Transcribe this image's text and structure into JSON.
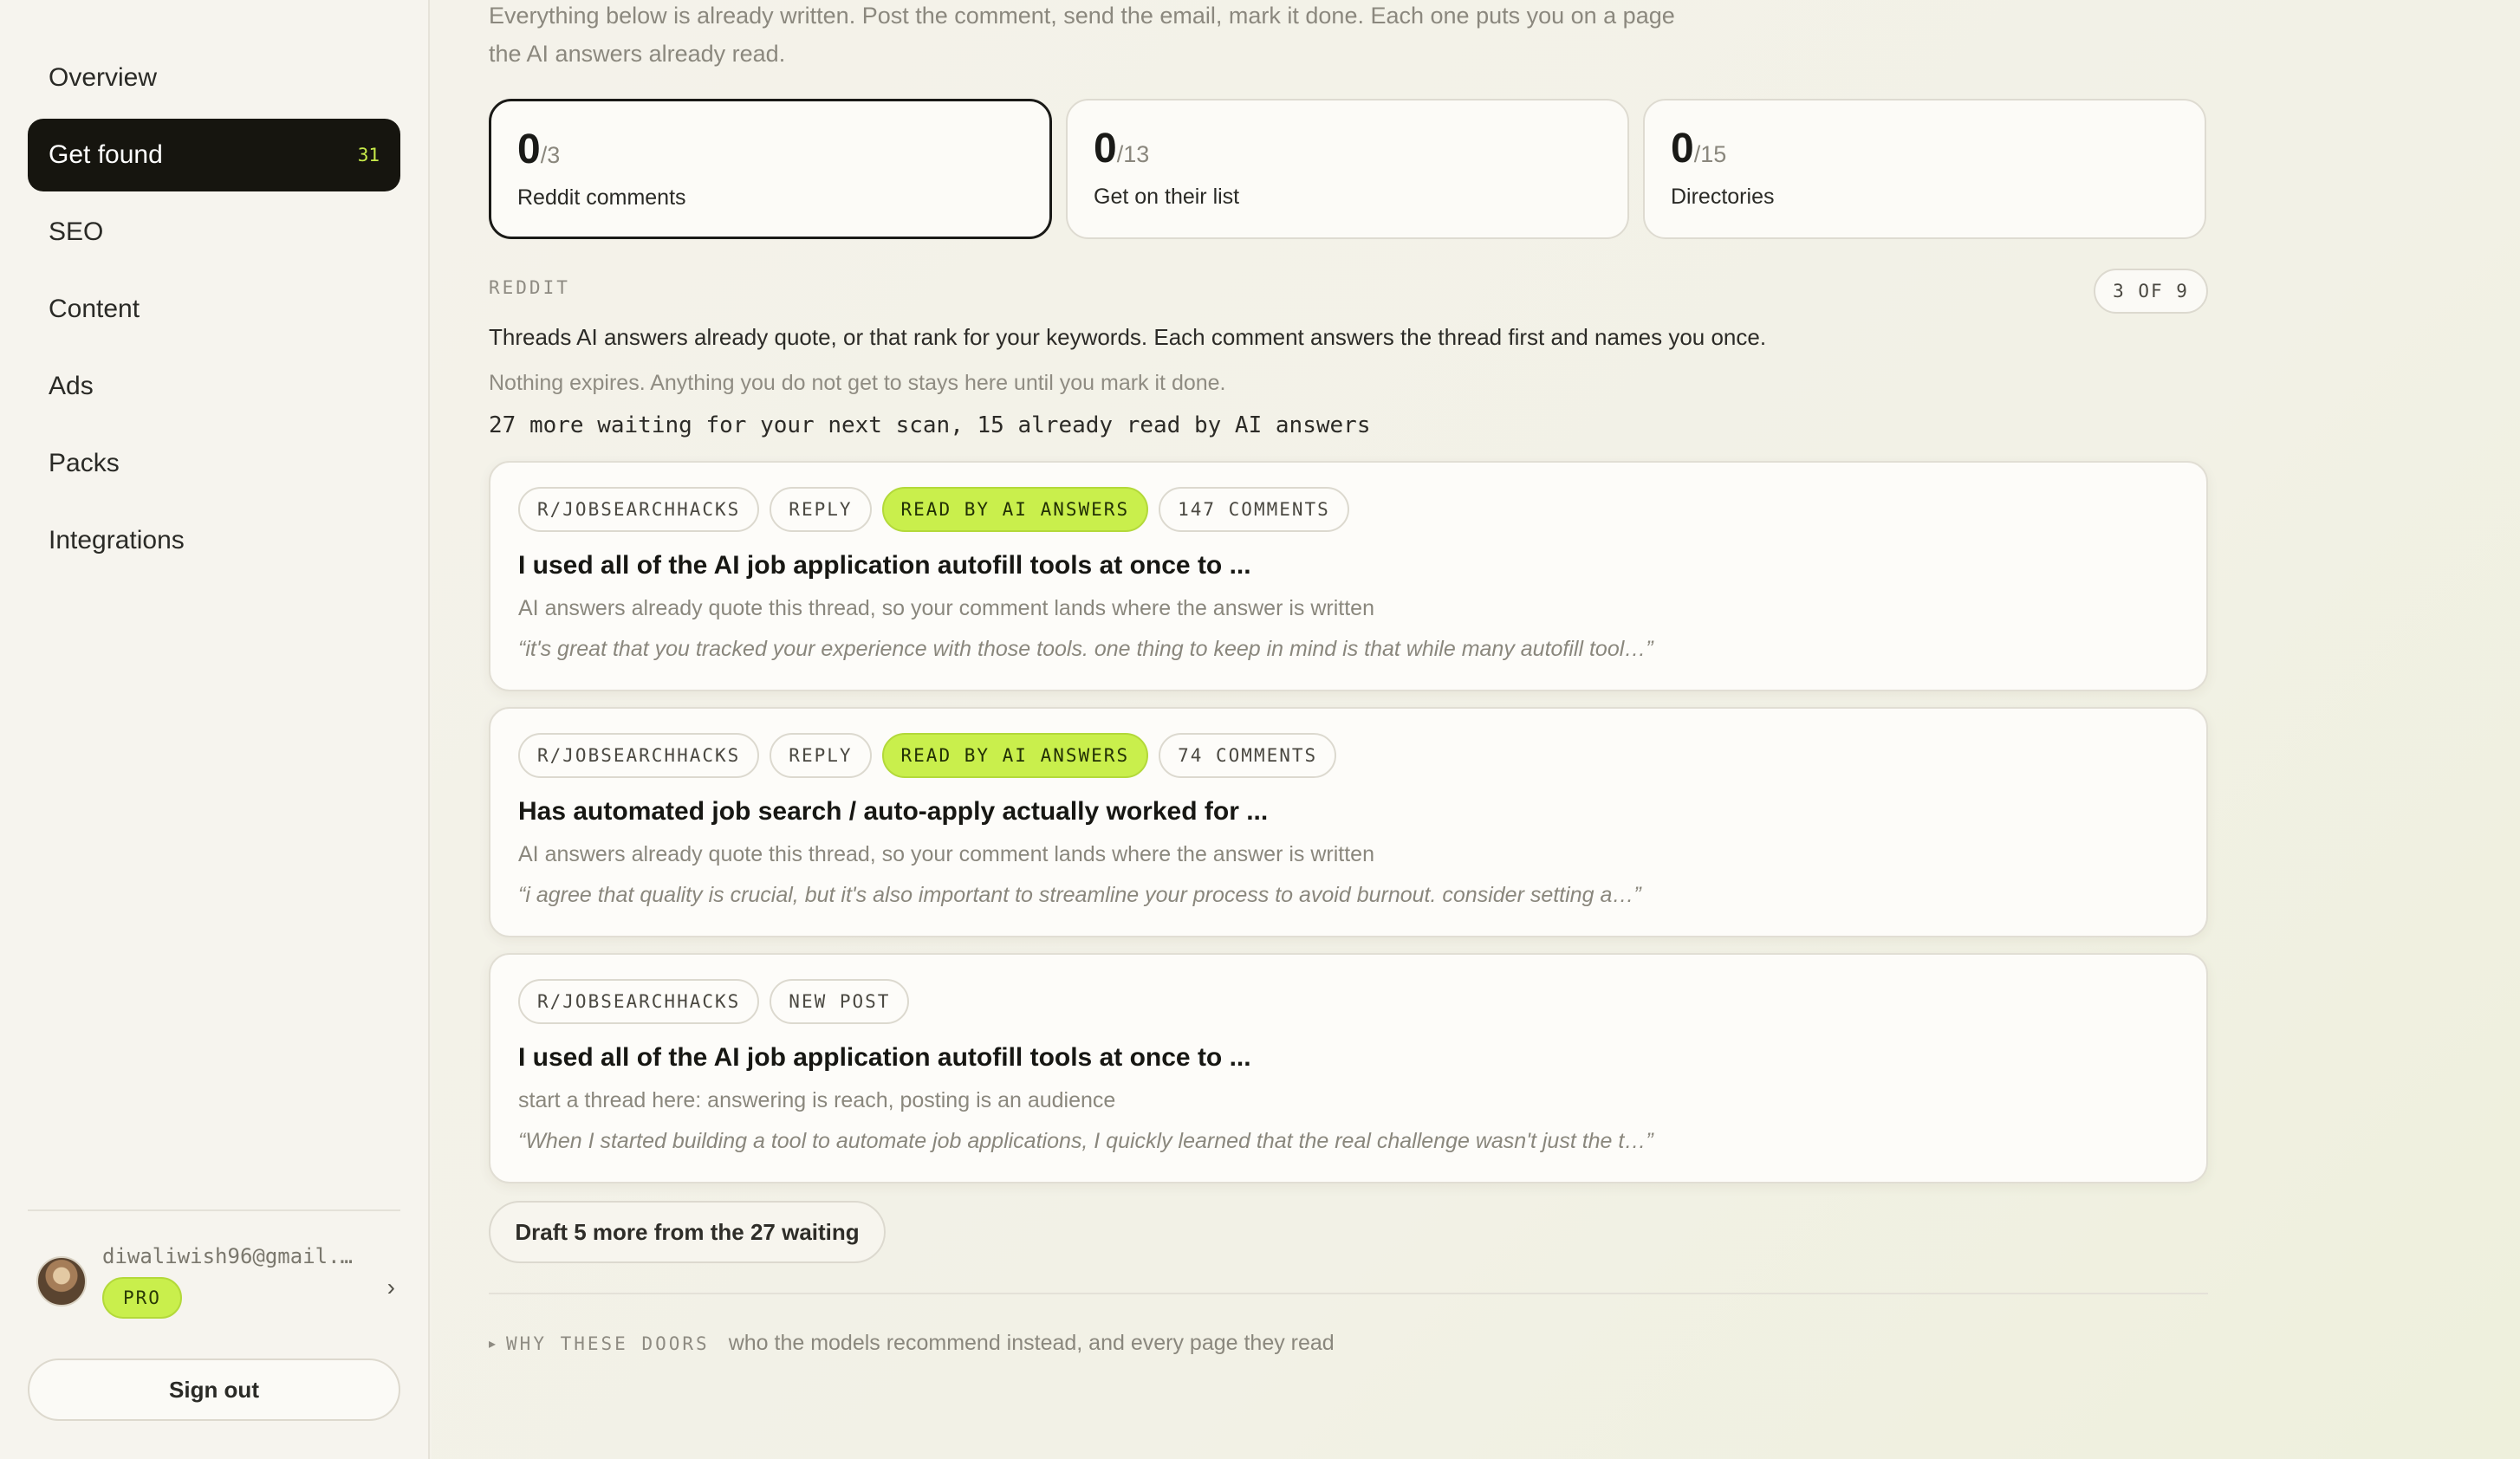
{
  "sidebar": {
    "nav": [
      {
        "label": "Overview"
      },
      {
        "label": "Get found",
        "count": "31",
        "active": true
      },
      {
        "label": "SEO"
      },
      {
        "label": "Content"
      },
      {
        "label": "Ads"
      },
      {
        "label": "Packs"
      },
      {
        "label": "Integrations"
      }
    ],
    "account": {
      "email": "diwaliwish96@gmail.…",
      "plan": "PRO"
    },
    "sign_out": "Sign out"
  },
  "main": {
    "intro": "Everything below is already written. Post the comment, send the email, mark it done. Each one puts you on a page the AI answers already read.",
    "stats": [
      {
        "count": "0",
        "total": "/3",
        "label": "Reddit comments",
        "active": true
      },
      {
        "count": "0",
        "total": "/13",
        "label": "Get on their list"
      },
      {
        "count": "0",
        "total": "/15",
        "label": "Directories"
      }
    ],
    "section_label": "REDDIT",
    "pager": "3 OF 9",
    "description": "Threads AI answers already quote, or that rank for your keywords. Each comment answers the thread first and names you once.",
    "subdescription": "Nothing expires. Anything you do not get to stays here until you mark it done.",
    "waiting": "27 more waiting for your next scan, 15 already read by AI answers",
    "cards": [
      {
        "tags": [
          "R/JOBSEARCHHACKS",
          "REPLY",
          "READ BY AI ANSWERS",
          "147 COMMENTS"
        ],
        "title": "I used all of the AI job application autofill tools at once to ...",
        "why": "AI answers already quote this thread, so your comment lands where the answer is written",
        "quote": "“it's great that you tracked your experience with those tools. one thing to keep in mind is that while many autofill tool…”"
      },
      {
        "tags": [
          "R/JOBSEARCHHACKS",
          "REPLY",
          "READ BY AI ANSWERS",
          "74 COMMENTS"
        ],
        "title": "Has automated job search / auto-apply actually worked for ...",
        "why": "AI answers already quote this thread, so your comment lands where the answer is written",
        "quote": "“i agree that quality is crucial, but it's also important to streamline your process to avoid burnout. consider setting a…”"
      },
      {
        "tags": [
          "R/JOBSEARCHHACKS",
          "NEW POST"
        ],
        "title": "I used all of the AI job application autofill tools at once to ...",
        "why": "start a thread here: answering is reach, posting is an audience",
        "quote": "“When I started building a tool to automate job applications, I quickly learned that the real challenge wasn't just the t…”"
      }
    ],
    "draft_button": "Draft 5 more from the 27 waiting",
    "why_label": "WHY THESE DOORS",
    "why_text": "who the models recommend instead, and every page they read"
  },
  "colors": {
    "accent": "#c9ef4c",
    "dark": "#16150f",
    "background": "#f4f2ea"
  }
}
